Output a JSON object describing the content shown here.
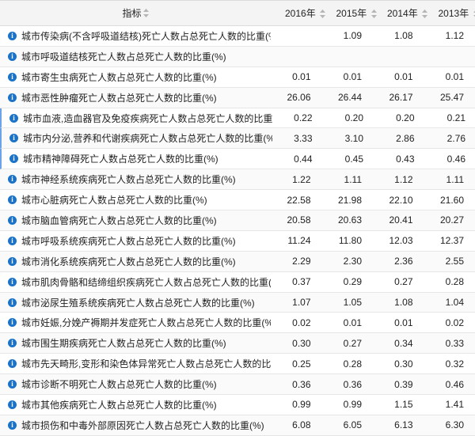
{
  "columns": {
    "indicator": "指标",
    "y2016": "2016年",
    "y2015": "2015年",
    "y2014": "2014年",
    "y2013": "2013年"
  },
  "rows": [
    {
      "name": "城市传染病(不含呼吸道结核)死亡人数占总死亡人数的比重(%)",
      "v2016": "",
      "v2015": "1.09",
      "v2014": "1.08",
      "v2013": "1.12"
    },
    {
      "name": "城市呼吸道结核死亡人数占总死亡人数的比重(%)",
      "v2016": "",
      "v2015": "",
      "v2014": "",
      "v2013": ""
    },
    {
      "name": "城市寄生虫病死亡人数占总死亡人数的比重(%)",
      "v2016": "0.01",
      "v2015": "0.01",
      "v2014": "0.01",
      "v2013": "0.01"
    },
    {
      "name": "城市恶性肿瘤死亡人数占总死亡人数的比重(%)",
      "v2016": "26.06",
      "v2015": "26.44",
      "v2014": "26.17",
      "v2013": "25.47"
    },
    {
      "name": "城市血液,造血器官及免疫疾病死亡人数占总死亡人数的比重(%)",
      "v2016": "0.22",
      "v2015": "0.20",
      "v2014": "0.20",
      "v2013": "0.21"
    },
    {
      "name": "城市内分泌,营养和代谢疾病死亡人数占总死亡人数的比重(%)",
      "v2016": "3.33",
      "v2015": "3.10",
      "v2014": "2.86",
      "v2013": "2.76"
    },
    {
      "name": "城市精神障碍死亡人数占总死亡人数的比重(%)",
      "v2016": "0.44",
      "v2015": "0.45",
      "v2014": "0.43",
      "v2013": "0.46"
    },
    {
      "name": "城市神经系统疾病死亡人数占总死亡人数的比重(%)",
      "v2016": "1.22",
      "v2015": "1.11",
      "v2014": "1.12",
      "v2013": "1.11"
    },
    {
      "name": "城市心脏病死亡人数占总死亡人数的比重(%)",
      "v2016": "22.58",
      "v2015": "21.98",
      "v2014": "22.10",
      "v2013": "21.60"
    },
    {
      "name": "城市脑血管病死亡人数占总死亡人数的比重(%)",
      "v2016": "20.58",
      "v2015": "20.63",
      "v2014": "20.41",
      "v2013": "20.27"
    },
    {
      "name": "城市呼吸系统疾病死亡人数占总死亡人数的比重(%)",
      "v2016": "11.24",
      "v2015": "11.80",
      "v2014": "12.03",
      "v2013": "12.37"
    },
    {
      "name": "城市消化系统疾病死亡人数占总死亡人数的比重(%)",
      "v2016": "2.29",
      "v2015": "2.30",
      "v2014": "2.36",
      "v2013": "2.55"
    },
    {
      "name": "城市肌肉骨骼和结缔组织疾病死亡人数占总死亡人数的比重(%)",
      "v2016": "0.37",
      "v2015": "0.29",
      "v2014": "0.27",
      "v2013": "0.28"
    },
    {
      "name": "城市泌尿生殖系统疾病死亡人数占总死亡人数的比重(%)",
      "v2016": "1.07",
      "v2015": "1.05",
      "v2014": "1.08",
      "v2013": "1.04"
    },
    {
      "name": "城市妊娠,分娩产褥期并发症死亡人数占总死亡人数的比重(%)",
      "v2016": "0.02",
      "v2015": "0.01",
      "v2014": "0.01",
      "v2013": "0.02"
    },
    {
      "name": "城市围生期疾病死亡人数占总死亡人数的比重(%)",
      "v2016": "0.30",
      "v2015": "0.27",
      "v2014": "0.34",
      "v2013": "0.33"
    },
    {
      "name": "城市先天畸形,变形和染色体异常死亡人数占总死亡人数的比重(%)",
      "v2016": "0.25",
      "v2015": "0.28",
      "v2014": "0.30",
      "v2013": "0.32"
    },
    {
      "name": "城市诊断不明死亡人数占总死亡人数的比重(%)",
      "v2016": "0.36",
      "v2015": "0.36",
      "v2014": "0.39",
      "v2013": "0.46"
    },
    {
      "name": "城市其他疾病死亡人数占总死亡人数的比重(%)",
      "v2016": "0.99",
      "v2015": "0.99",
      "v2014": "1.15",
      "v2013": "1.41"
    },
    {
      "name": "城市损伤和中毒外部原因死亡人数占总死亡人数的比重(%)",
      "v2016": "6.08",
      "v2015": "6.05",
      "v2014": "6.13",
      "v2013": "6.30"
    }
  ],
  "icons": {
    "row_icon": "info-icon",
    "sort": "sort-icon"
  },
  "colors": {
    "icon_blue": "#1a73c9",
    "header_bg": "#f4f4f4",
    "row_marker": "#6aa3e8"
  }
}
